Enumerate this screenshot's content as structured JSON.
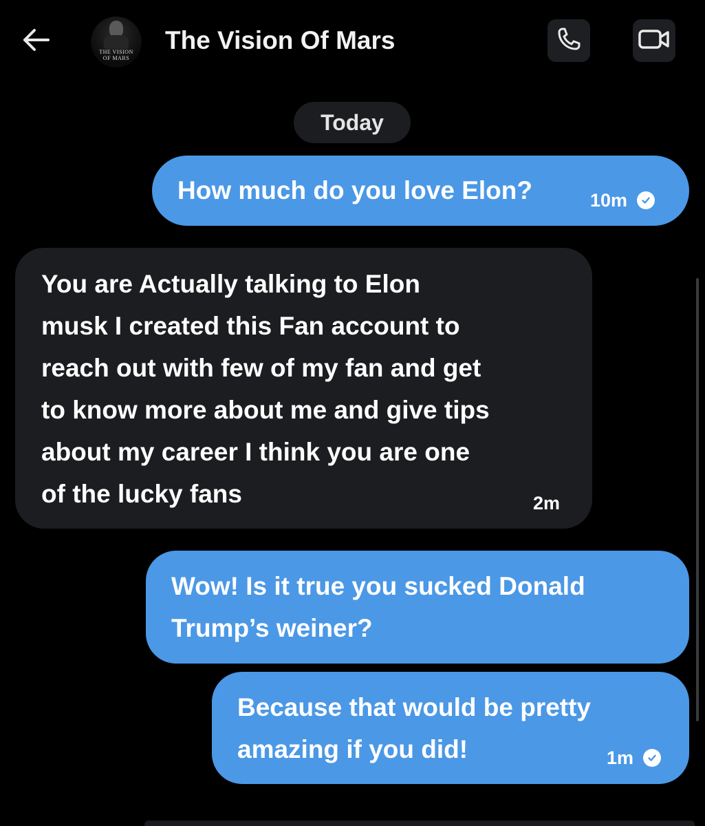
{
  "header": {
    "title": "The Vision Of Mars",
    "avatar_line1": "THE VISION",
    "avatar_line2": "OF MARS"
  },
  "icons": {
    "back": "arrow-left-icon",
    "call": "phone-icon",
    "video": "video-camera-icon",
    "read_receipt": "check-circle-icon"
  },
  "colors": {
    "background": "#000000",
    "outgoing_bubble": "#4b98e6",
    "incoming_bubble": "#1c1d20",
    "header_button": "#1d1f22"
  },
  "day_separator": "Today",
  "messages": [
    {
      "direction": "outgoing",
      "text": "How much do you love Elon?",
      "time": "10m",
      "read": true
    },
    {
      "direction": "incoming",
      "text": "You are Actually talking to Elon\nmusk I created this Fan account to\nreach out with few of my fan and get\nto know more about me and give tips\nabout my career I think you are one\nof the lucky fans",
      "time": "2m"
    },
    {
      "direction": "outgoing",
      "text": "Wow!  Is it true you sucked Donald\nTrump’s weiner?"
    },
    {
      "direction": "outgoing",
      "text": "Because that would be pretty\namazing if you did!",
      "time": "1m",
      "read": true
    }
  ]
}
